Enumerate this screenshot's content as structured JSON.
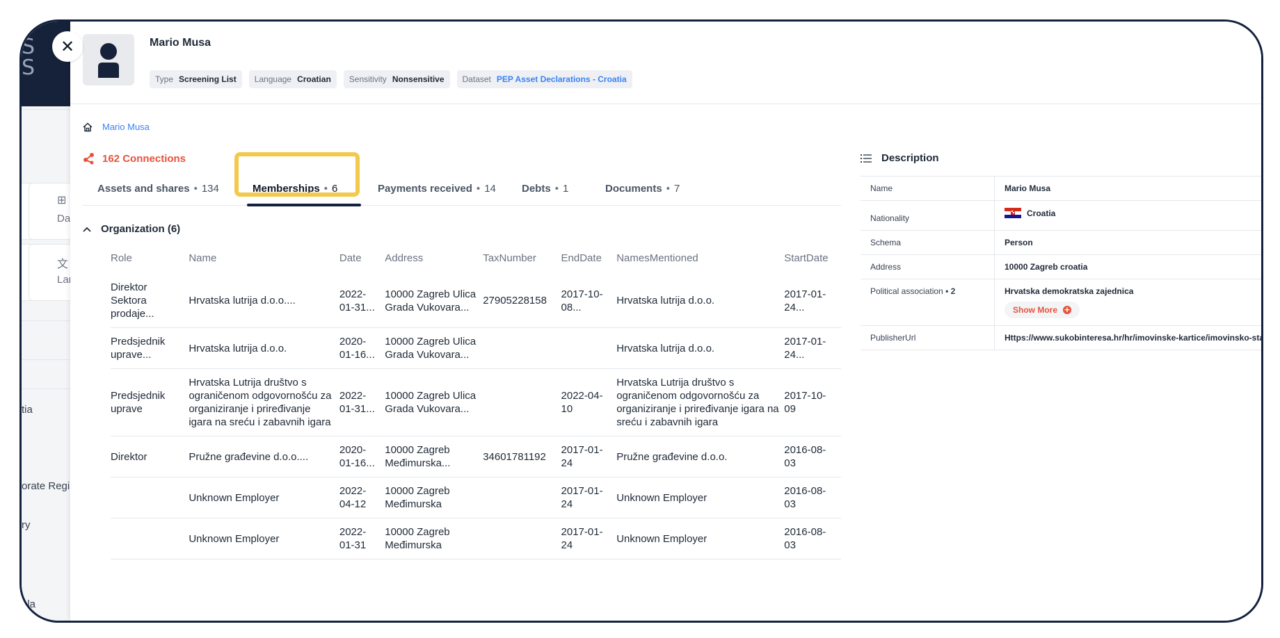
{
  "background_app": {
    "logo_fragment": "S\nS",
    "cards": [
      "Dat",
      "Lan"
    ],
    "nav": [
      "tia",
      "orate Regis",
      "ry",
      "ala"
    ]
  },
  "header": {
    "name": "Mario Musa",
    "tags": [
      {
        "key": "Type",
        "value": "Screening List"
      },
      {
        "key": "Language",
        "value": "Croatian"
      },
      {
        "key": "Sensitivity",
        "value": "Nonsensitive"
      },
      {
        "key": "Dataset",
        "value": "PEP Asset Declarations - Croatia"
      }
    ]
  },
  "breadcrumb": {
    "current": "Mario Musa"
  },
  "connections": {
    "label": "162 Connections"
  },
  "tabs": [
    {
      "label": "Assets and shares",
      "count": "134"
    },
    {
      "label": "Memberships",
      "count": "6"
    },
    {
      "label": "Payments received",
      "count": "14"
    },
    {
      "label": "Debts",
      "count": "1"
    },
    {
      "label": "Documents",
      "count": "7"
    }
  ],
  "section": {
    "title": "Organization (6)"
  },
  "table": {
    "columns": [
      "Role",
      "Name",
      "Date",
      "Address",
      "TaxNumber",
      "EndDate",
      "NamesMentioned",
      "StartDate"
    ],
    "rows": [
      [
        "Direktor Sektora prodaje...",
        "Hrvatska lutrija d.o.o....",
        "2022-01-31...",
        "10000 Zagreb Ulica Grada Vukovara...",
        "27905228158",
        "2017-10-08...",
        "Hrvatska lutrija d.o.o.",
        "2017-01-24..."
      ],
      [
        "Predsjednik uprave...",
        "Hrvatska lutrija d.o.o.",
        "2020-01-16...",
        "10000 Zagreb Ulica Grada Vukovara...",
        "",
        "",
        "Hrvatska lutrija d.o.o.",
        "2017-01-24..."
      ],
      [
        "Predsjednik uprave",
        "Hrvatska Lutrija društvo s ograničenom odgovornošću za organiziranje i priređivanje igara na sreću i zabavnih igara",
        "2022-01-31...",
        "10000 Zagreb Ulica Grada Vukovara...",
        "",
        "2022-04-10",
        "Hrvatska Lutrija društvo s ograničenom odgovornošću za organiziranje i priređivanje igara na sreću i zabavnih igara",
        "2017-10-09"
      ],
      [
        "Direktor",
        "Pružne građevine d.o.o....",
        "2020-01-16...",
        "10000 Zagreb Međimurska...",
        "34601781192",
        "2017-01-24",
        "Pružne građevine d.o.o.",
        "2016-08-03"
      ],
      [
        "",
        "Unknown Employer",
        "2022-04-12",
        "10000 Zagreb Međimurska",
        "",
        "2017-01-24",
        "Unknown Employer",
        "2016-08-03"
      ],
      [
        "",
        "Unknown Employer",
        "2022-01-31",
        "10000 Zagreb Međimurska",
        "",
        "2017-01-24",
        "Unknown Employer",
        "2016-08-03"
      ]
    ]
  },
  "description": {
    "title": "Description",
    "rows": {
      "name": {
        "key": "Name",
        "value": "Mario Musa"
      },
      "nationality": {
        "key": "Nationality",
        "value": "Croatia"
      },
      "schema": {
        "key": "Schema",
        "value": "Person"
      },
      "address": {
        "key": "Address",
        "value": "10000 Zagreb croatia"
      },
      "political": {
        "key": "Political association",
        "count": "• 2",
        "value": "Hrvatska demokratska zajednica",
        "show_more": "Show More"
      },
      "publisher": {
        "key": "PublisherUrl",
        "value": "Https://www.sukobinteresa.hr/hr/imovinske-kartice/imovinsko-stan"
      }
    }
  },
  "colors": {
    "accent_red": "#e5533d",
    "link_blue": "#3b82f6",
    "navy": "#14213d",
    "highlight": "#f2c94c"
  }
}
